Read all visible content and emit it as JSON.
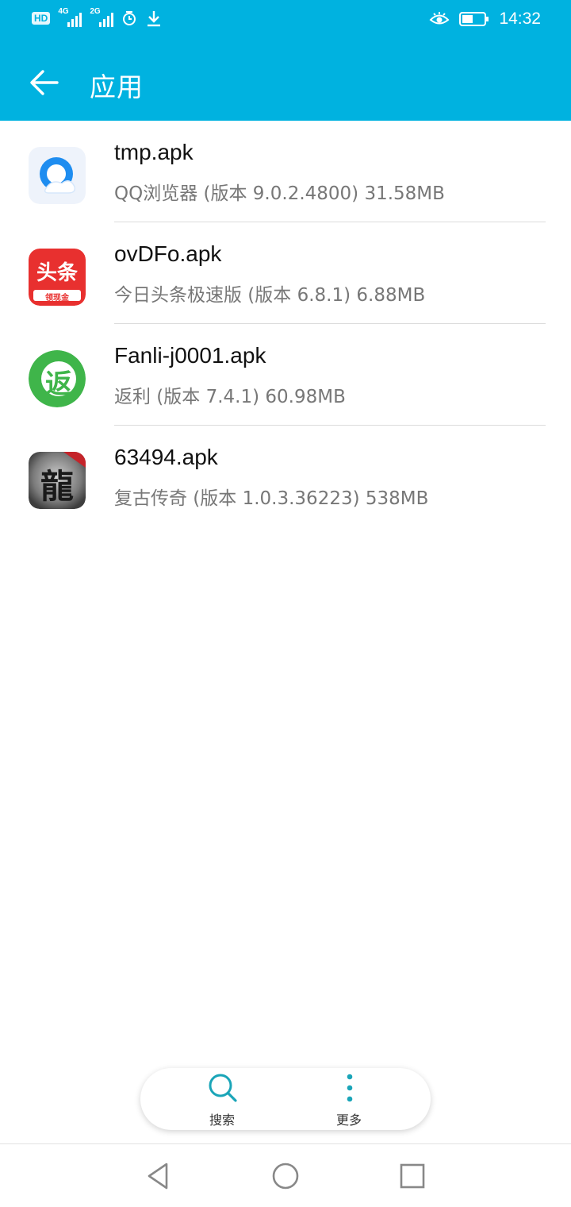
{
  "status_bar": {
    "hd_badge": "HD",
    "network_1": "4G",
    "network_2": "2G",
    "time": "14:32",
    "icons": [
      "signal-icon",
      "alarm-icon",
      "download-icon",
      "eye-icon",
      "battery-icon"
    ]
  },
  "header": {
    "title": "应用",
    "back_icon": "arrow-left-icon",
    "background": "#00b2e0"
  },
  "apps": [
    {
      "file": "tmp.apk",
      "info": "QQ浏览器 (版本 9.0.2.4800) 31.58MB",
      "icon": "qq-browser-icon"
    },
    {
      "file": "ovDFo.apk",
      "info": "今日头条极速版 (版本 6.8.1) 6.88MB",
      "icon": "toutiao-icon",
      "icon_text": "头条",
      "icon_subtext": "领现金"
    },
    {
      "file": "Fanli-j0001.apk",
      "info": "返利 (版本 7.4.1) 60.98MB",
      "icon": "fanli-icon",
      "icon_text": "返"
    },
    {
      "file": "63494.apk",
      "info": "复古传奇 (版本 1.0.3.36223) 538MB",
      "icon": "dragon-game-icon",
      "icon_text": "龍"
    }
  ],
  "bottom_actions": {
    "search_label": "搜索",
    "more_label": "更多",
    "accent": "#1aa5b8"
  },
  "nav": {
    "icons": [
      "back-triangle-icon",
      "home-circle-icon",
      "recents-square-icon"
    ]
  }
}
